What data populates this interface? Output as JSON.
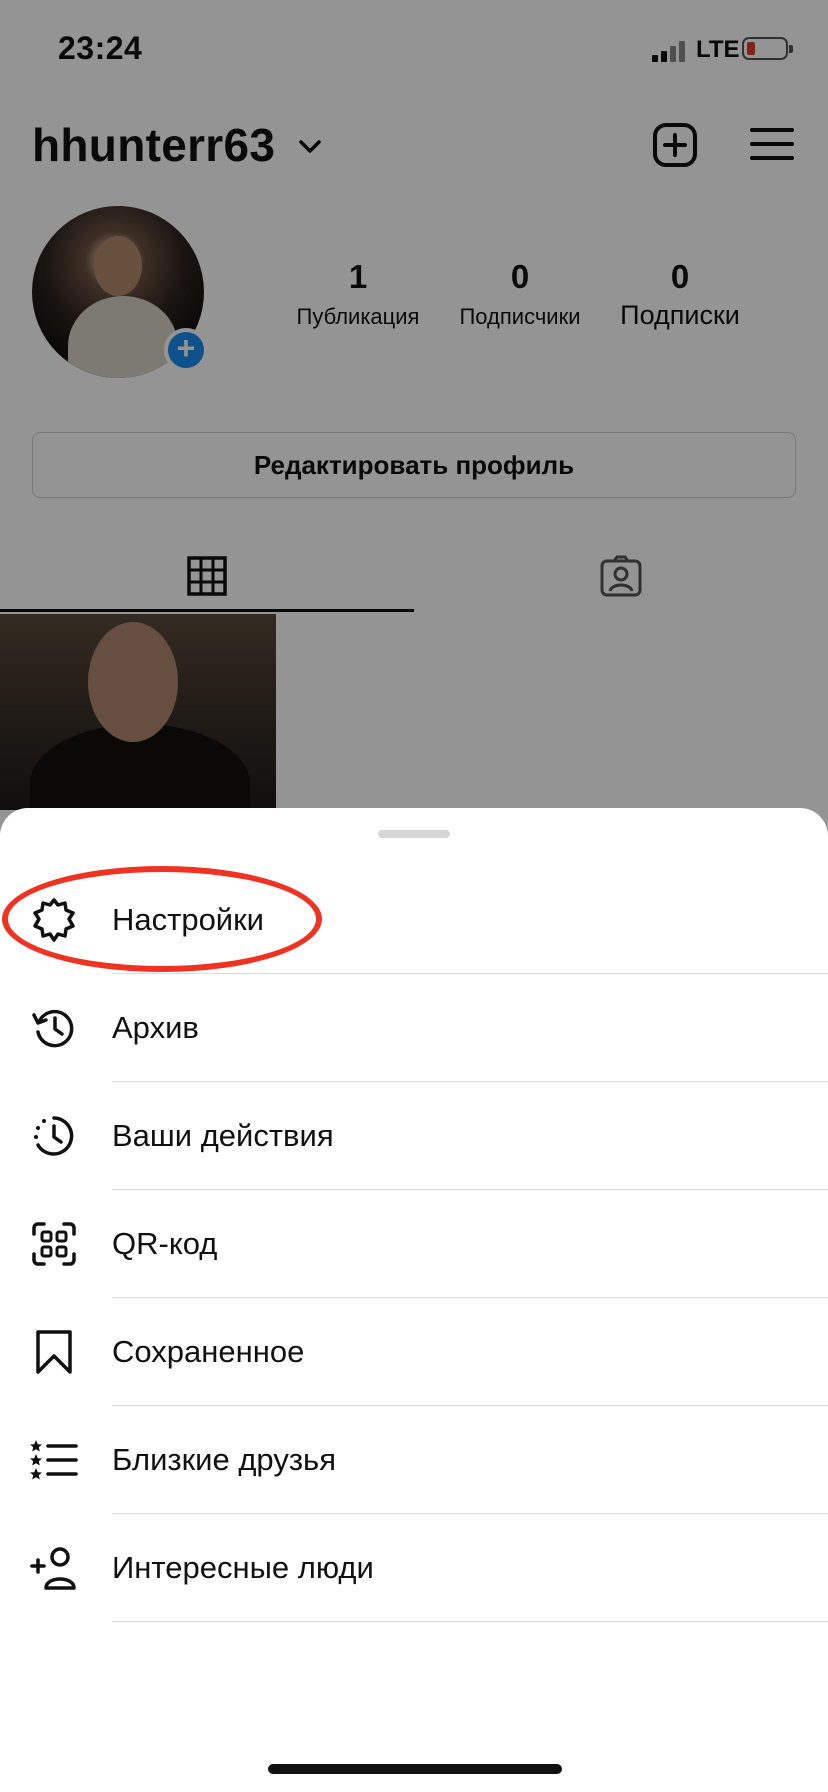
{
  "status_bar": {
    "time": "23:24",
    "network": "LTE",
    "battery_color": "#e23b2e"
  },
  "profile": {
    "username": "hhunterr63",
    "stats": [
      {
        "value": "1",
        "label": "Публикация"
      },
      {
        "value": "0",
        "label": "Подписчики"
      },
      {
        "value": "0",
        "label": "Подписки"
      }
    ],
    "edit_profile_label": "Редактировать профиль",
    "add_story_symbol": "+"
  },
  "tabs": [
    {
      "icon": "grid-icon",
      "active": true
    },
    {
      "icon": "tagged-photos-icon",
      "active": false
    }
  ],
  "menu": {
    "items": [
      {
        "label": "Настройки",
        "icon": "settings-gear-icon",
        "highlighted": true
      },
      {
        "label": "Архив",
        "icon": "archive-history-icon"
      },
      {
        "label": "Ваши действия",
        "icon": "activity-clock-icon"
      },
      {
        "label": "QR-код",
        "icon": "qr-code-icon"
      },
      {
        "label": "Сохраненное",
        "icon": "bookmark-icon"
      },
      {
        "label": "Близкие друзья",
        "icon": "close-friends-list-icon"
      },
      {
        "label": "Интересные люди",
        "icon": "discover-people-icon"
      }
    ]
  },
  "colors": {
    "highlight": "#ee3322",
    "accent": "#1a8cf0"
  }
}
